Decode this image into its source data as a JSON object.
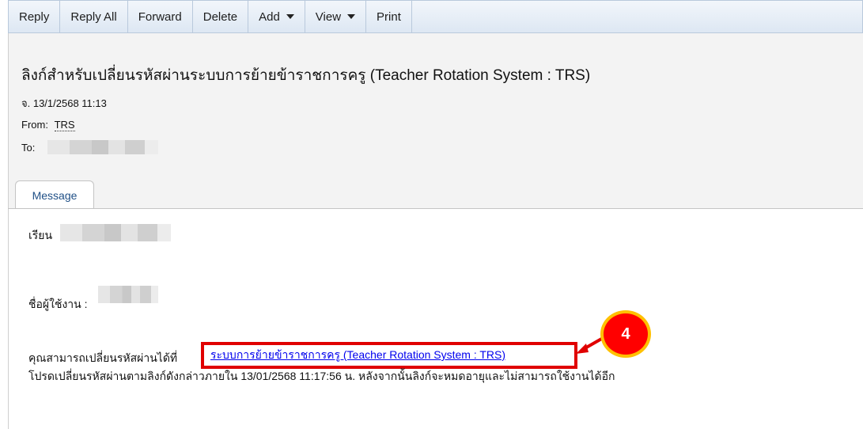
{
  "toolbar": {
    "reply": "Reply",
    "reply_all": "Reply All",
    "forward": "Forward",
    "delete": "Delete",
    "add": "Add",
    "view": "View",
    "print": "Print"
  },
  "email": {
    "subject": "ลิงก์สำหรับเปลี่ยนรหัสผ่านระบบการย้ายข้าราชการครู (Teacher Rotation System : TRS)",
    "date": "จ. 13/1/2568 11:13",
    "from_label": "From:",
    "from_name": "TRS",
    "to_label": "To:",
    "tab_message": "Message"
  },
  "body": {
    "greeting": "เรียน",
    "username_label": "ชื่อผู้ใช้งาน :",
    "change_prefix": "คุณสามารถเปลี่ยนรหัสผ่านได้ที่",
    "link_text": "ระบบการย้ายข้าราชการครู (Teacher Rotation System : TRS)",
    "notice": "โปรดเปลี่ยนรหัสผ่านตามลิงก์ดังกล่าวภายใน 13/01/2568 11:17:56 น. หลังจากนั้นลิงก์จะหมดอายุและไม่สามารถใช้งานได้อีก"
  },
  "annotation": {
    "step_number": "4",
    "color": "#ff0000",
    "ring_color": "#ffc000"
  }
}
